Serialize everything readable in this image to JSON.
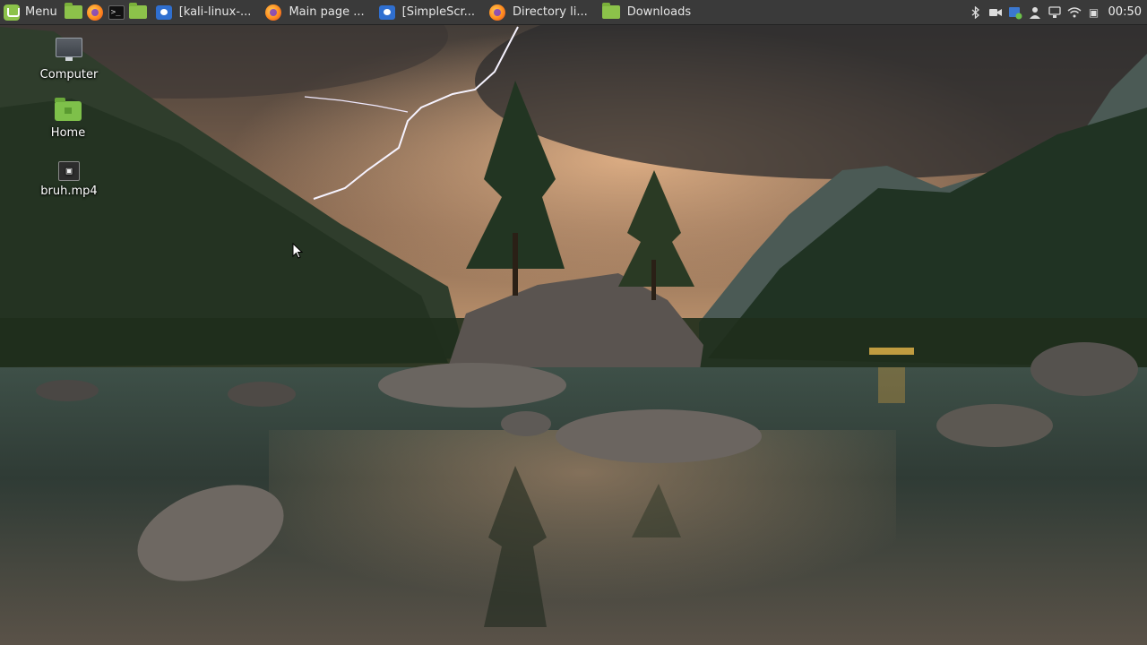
{
  "panel": {
    "menu_label": "Menu",
    "launchers": [
      {
        "icon": "folder-icon"
      },
      {
        "icon": "firefox-icon"
      },
      {
        "icon": "terminal-icon"
      },
      {
        "icon": "folder-icon"
      }
    ],
    "tasks": [
      {
        "label": "[kali-linux-...",
        "icon": "screenshot-app-icon"
      },
      {
        "label": "Main page ...",
        "icon": "firefox-icon"
      },
      {
        "label": "[SimpleScr...",
        "icon": "screenshot-app-icon"
      },
      {
        "label": "Directory li...",
        "icon": "firefox-icon"
      },
      {
        "label": "Downloads",
        "icon": "folder-icon"
      }
    ],
    "tray": {
      "icons": [
        "bluetooth-icon",
        "camera-icon",
        "update-manager-icon",
        "user-icon",
        "network-icon",
        "wifi-icon",
        "battery-icon"
      ],
      "battery_glyph": "▣",
      "clock": "00:50"
    }
  },
  "desktop": {
    "icons": [
      {
        "label": "Computer",
        "icon": "computer-icon"
      },
      {
        "label": "Home",
        "icon": "home-folder-icon"
      },
      {
        "label": "bruh.mp4",
        "icon": "video-file-icon",
        "glyph": "▣"
      }
    ]
  },
  "colors": {
    "panel_bg": "#3a3a3a",
    "mint_green": "#8cc24a"
  }
}
